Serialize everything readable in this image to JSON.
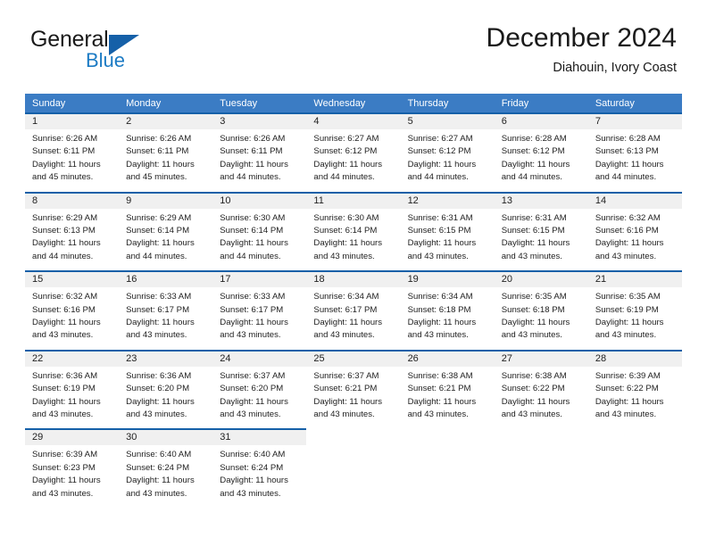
{
  "brand": {
    "name_part1": "General",
    "name_part2": "Blue"
  },
  "header": {
    "title": "December 2024",
    "subtitle": "Diahouin, Ivory Coast"
  },
  "colors": {
    "header_blue": "#3b7cc4",
    "row_border_blue": "#1560a8",
    "date_band": "#f0f0f0",
    "logo_blue": "#1c7bc4"
  },
  "weekdays": [
    "Sunday",
    "Monday",
    "Tuesday",
    "Wednesday",
    "Thursday",
    "Friday",
    "Saturday"
  ],
  "labels": {
    "sunrise_prefix": "Sunrise: ",
    "sunset_prefix": "Sunset: ",
    "daylight_prefix": "Daylight: "
  },
  "weeks": [
    [
      {
        "day": "1",
        "sunrise": "Sunrise: 6:26 AM",
        "sunset": "Sunset: 6:11 PM",
        "daylight1": "Daylight: 11 hours",
        "daylight2": "and 45 minutes."
      },
      {
        "day": "2",
        "sunrise": "Sunrise: 6:26 AM",
        "sunset": "Sunset: 6:11 PM",
        "daylight1": "Daylight: 11 hours",
        "daylight2": "and 45 minutes."
      },
      {
        "day": "3",
        "sunrise": "Sunrise: 6:26 AM",
        "sunset": "Sunset: 6:11 PM",
        "daylight1": "Daylight: 11 hours",
        "daylight2": "and 44 minutes."
      },
      {
        "day": "4",
        "sunrise": "Sunrise: 6:27 AM",
        "sunset": "Sunset: 6:12 PM",
        "daylight1": "Daylight: 11 hours",
        "daylight2": "and 44 minutes."
      },
      {
        "day": "5",
        "sunrise": "Sunrise: 6:27 AM",
        "sunset": "Sunset: 6:12 PM",
        "daylight1": "Daylight: 11 hours",
        "daylight2": "and 44 minutes."
      },
      {
        "day": "6",
        "sunrise": "Sunrise: 6:28 AM",
        "sunset": "Sunset: 6:12 PM",
        "daylight1": "Daylight: 11 hours",
        "daylight2": "and 44 minutes."
      },
      {
        "day": "7",
        "sunrise": "Sunrise: 6:28 AM",
        "sunset": "Sunset: 6:13 PM",
        "daylight1": "Daylight: 11 hours",
        "daylight2": "and 44 minutes."
      }
    ],
    [
      {
        "day": "8",
        "sunrise": "Sunrise: 6:29 AM",
        "sunset": "Sunset: 6:13 PM",
        "daylight1": "Daylight: 11 hours",
        "daylight2": "and 44 minutes."
      },
      {
        "day": "9",
        "sunrise": "Sunrise: 6:29 AM",
        "sunset": "Sunset: 6:14 PM",
        "daylight1": "Daylight: 11 hours",
        "daylight2": "and 44 minutes."
      },
      {
        "day": "10",
        "sunrise": "Sunrise: 6:30 AM",
        "sunset": "Sunset: 6:14 PM",
        "daylight1": "Daylight: 11 hours",
        "daylight2": "and 44 minutes."
      },
      {
        "day": "11",
        "sunrise": "Sunrise: 6:30 AM",
        "sunset": "Sunset: 6:14 PM",
        "daylight1": "Daylight: 11 hours",
        "daylight2": "and 43 minutes."
      },
      {
        "day": "12",
        "sunrise": "Sunrise: 6:31 AM",
        "sunset": "Sunset: 6:15 PM",
        "daylight1": "Daylight: 11 hours",
        "daylight2": "and 43 minutes."
      },
      {
        "day": "13",
        "sunrise": "Sunrise: 6:31 AM",
        "sunset": "Sunset: 6:15 PM",
        "daylight1": "Daylight: 11 hours",
        "daylight2": "and 43 minutes."
      },
      {
        "day": "14",
        "sunrise": "Sunrise: 6:32 AM",
        "sunset": "Sunset: 6:16 PM",
        "daylight1": "Daylight: 11 hours",
        "daylight2": "and 43 minutes."
      }
    ],
    [
      {
        "day": "15",
        "sunrise": "Sunrise: 6:32 AM",
        "sunset": "Sunset: 6:16 PM",
        "daylight1": "Daylight: 11 hours",
        "daylight2": "and 43 minutes."
      },
      {
        "day": "16",
        "sunrise": "Sunrise: 6:33 AM",
        "sunset": "Sunset: 6:17 PM",
        "daylight1": "Daylight: 11 hours",
        "daylight2": "and 43 minutes."
      },
      {
        "day": "17",
        "sunrise": "Sunrise: 6:33 AM",
        "sunset": "Sunset: 6:17 PM",
        "daylight1": "Daylight: 11 hours",
        "daylight2": "and 43 minutes."
      },
      {
        "day": "18",
        "sunrise": "Sunrise: 6:34 AM",
        "sunset": "Sunset: 6:17 PM",
        "daylight1": "Daylight: 11 hours",
        "daylight2": "and 43 minutes."
      },
      {
        "day": "19",
        "sunrise": "Sunrise: 6:34 AM",
        "sunset": "Sunset: 6:18 PM",
        "daylight1": "Daylight: 11 hours",
        "daylight2": "and 43 minutes."
      },
      {
        "day": "20",
        "sunrise": "Sunrise: 6:35 AM",
        "sunset": "Sunset: 6:18 PM",
        "daylight1": "Daylight: 11 hours",
        "daylight2": "and 43 minutes."
      },
      {
        "day": "21",
        "sunrise": "Sunrise: 6:35 AM",
        "sunset": "Sunset: 6:19 PM",
        "daylight1": "Daylight: 11 hours",
        "daylight2": "and 43 minutes."
      }
    ],
    [
      {
        "day": "22",
        "sunrise": "Sunrise: 6:36 AM",
        "sunset": "Sunset: 6:19 PM",
        "daylight1": "Daylight: 11 hours",
        "daylight2": "and 43 minutes."
      },
      {
        "day": "23",
        "sunrise": "Sunrise: 6:36 AM",
        "sunset": "Sunset: 6:20 PM",
        "daylight1": "Daylight: 11 hours",
        "daylight2": "and 43 minutes."
      },
      {
        "day": "24",
        "sunrise": "Sunrise: 6:37 AM",
        "sunset": "Sunset: 6:20 PM",
        "daylight1": "Daylight: 11 hours",
        "daylight2": "and 43 minutes."
      },
      {
        "day": "25",
        "sunrise": "Sunrise: 6:37 AM",
        "sunset": "Sunset: 6:21 PM",
        "daylight1": "Daylight: 11 hours",
        "daylight2": "and 43 minutes."
      },
      {
        "day": "26",
        "sunrise": "Sunrise: 6:38 AM",
        "sunset": "Sunset: 6:21 PM",
        "daylight1": "Daylight: 11 hours",
        "daylight2": "and 43 minutes."
      },
      {
        "day": "27",
        "sunrise": "Sunrise: 6:38 AM",
        "sunset": "Sunset: 6:22 PM",
        "daylight1": "Daylight: 11 hours",
        "daylight2": "and 43 minutes."
      },
      {
        "day": "28",
        "sunrise": "Sunrise: 6:39 AM",
        "sunset": "Sunset: 6:22 PM",
        "daylight1": "Daylight: 11 hours",
        "daylight2": "and 43 minutes."
      }
    ],
    [
      {
        "day": "29",
        "sunrise": "Sunrise: 6:39 AM",
        "sunset": "Sunset: 6:23 PM",
        "daylight1": "Daylight: 11 hours",
        "daylight2": "and 43 minutes."
      },
      {
        "day": "30",
        "sunrise": "Sunrise: 6:40 AM",
        "sunset": "Sunset: 6:24 PM",
        "daylight1": "Daylight: 11 hours",
        "daylight2": "and 43 minutes."
      },
      {
        "day": "31",
        "sunrise": "Sunrise: 6:40 AM",
        "sunset": "Sunset: 6:24 PM",
        "daylight1": "Daylight: 11 hours",
        "daylight2": "and 43 minutes."
      },
      null,
      null,
      null,
      null
    ]
  ]
}
